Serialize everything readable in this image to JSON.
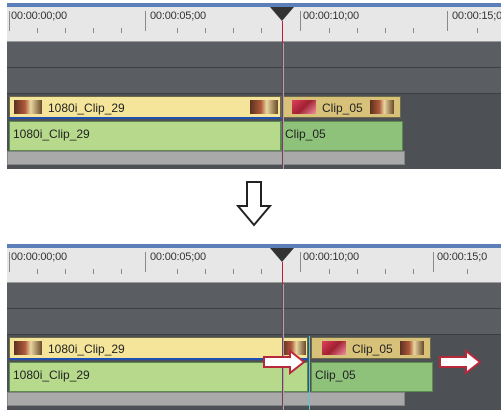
{
  "timecodes": [
    "00:00:00;00",
    "00:00:05;00",
    "00:00:10;00",
    "00:00:15;0"
  ],
  "before": {
    "video_clip_1": "1080i_Clip_29",
    "video_clip_2": "Clip_05",
    "audio_clip_1": "1080i_Clip_29",
    "audio_clip_2": "Clip_05"
  },
  "after": {
    "video_clip_1": "1080i_Clip_29",
    "video_clip_2": "Clip_05",
    "audio_clip_1": "1080i_Clip_29",
    "audio_clip_2": "Clip_05"
  },
  "colors": {
    "video_clip": "#f4e59a",
    "audio_clip": "#b6d98c",
    "audio_clip_active": "#8ec27a",
    "playhead": "#c02030",
    "arrow": "#b8283a"
  }
}
